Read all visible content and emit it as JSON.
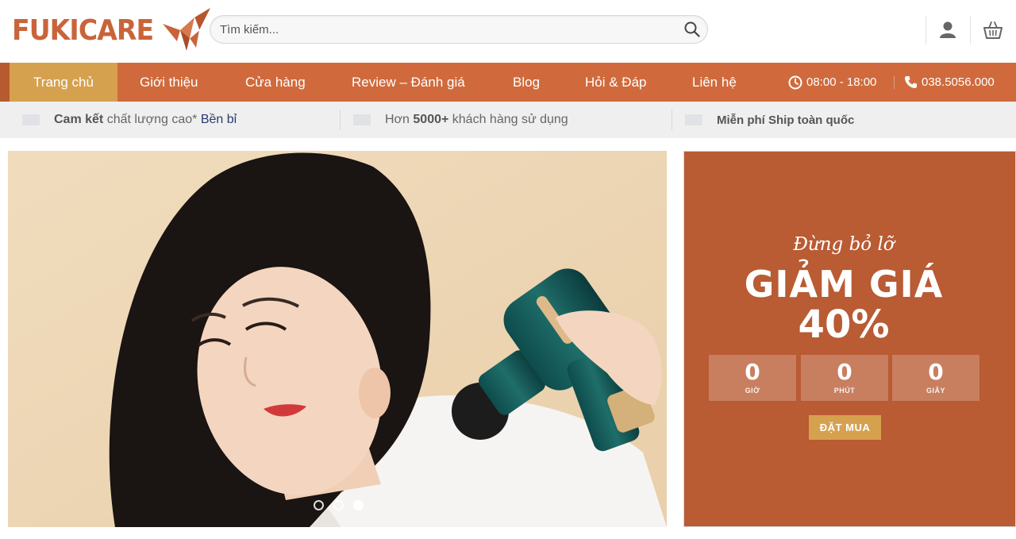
{
  "brand": {
    "name": "FUKICARE",
    "accent": "#c9643a"
  },
  "search": {
    "placeholder": "Tìm kiếm...",
    "icon": "search-icon"
  },
  "header_icons": [
    "user-icon",
    "basket-icon"
  ],
  "nav": {
    "items": [
      {
        "label": "Trang chủ",
        "active": true
      },
      {
        "label": "Giới thiệu"
      },
      {
        "label": "Cửa hàng"
      },
      {
        "label": "Review – Đánh giá"
      },
      {
        "label": "Blog"
      },
      {
        "label": "Hỏi & Đáp"
      },
      {
        "label": "Liên hệ"
      }
    ],
    "hours": "08:00 - 18:00",
    "phone": "038.5056.000",
    "bg_color": "#d06a3c",
    "active_color": "#d6a14e"
  },
  "promise": {
    "item1": {
      "bold": "Cam kết",
      "text": " chất lượng cao* ",
      "highlight": "Bền bỉ"
    },
    "item2": {
      "pre": "Hơn ",
      "bold": "5000+",
      "post": " khách hàng sử dụng"
    },
    "item3": {
      "bold": "Miễn phí Ship toàn quốc"
    }
  },
  "slider": {
    "slides": 3,
    "active_slide": 3
  },
  "promo": {
    "script": "Đừng bỏ lỡ",
    "title": "GIẢM GIÁ",
    "percent": "40%",
    "countdown": [
      {
        "value": "0",
        "label": "GIỜ"
      },
      {
        "value": "0",
        "label": "PHÚT"
      },
      {
        "value": "0",
        "label": "GIÂY"
      }
    ],
    "button": "ĐẶT MUA",
    "bg_color": "#b95b33"
  }
}
